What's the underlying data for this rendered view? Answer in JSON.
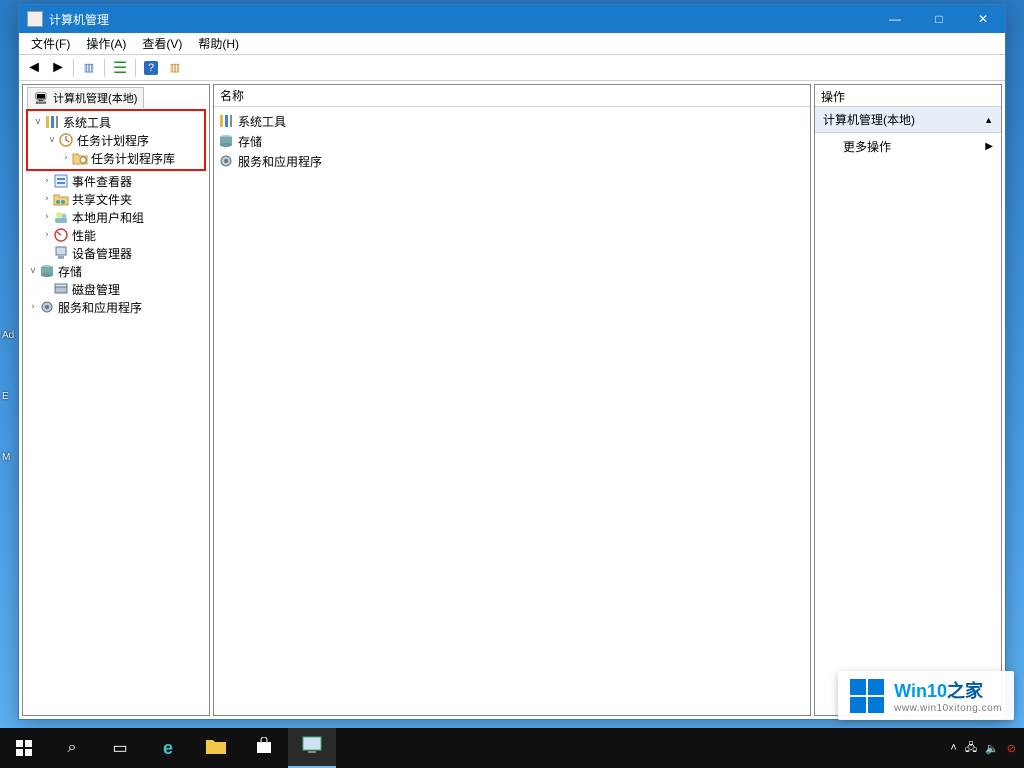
{
  "window": {
    "title": "计算机管理",
    "buttons": {
      "min": "—",
      "max": "□",
      "close": "✕"
    }
  },
  "menu": {
    "file": "文件(F)",
    "action": "操作(A)",
    "view": "查看(V)",
    "help": "帮助(H)"
  },
  "tree": {
    "root_tab": "计算机管理(本地)",
    "system_tools": "系统工具",
    "task_scheduler": "任务计划程序",
    "task_scheduler_lib": "任务计划程序库",
    "event_viewer": "事件查看器",
    "shared_folders": "共享文件夹",
    "local_users_groups": "本地用户和组",
    "performance": "性能",
    "device_manager": "设备管理器",
    "storage": "存储",
    "disk_management": "磁盘管理",
    "services_apps": "服务和应用程序"
  },
  "center": {
    "column_header": "名称",
    "rows": {
      "system_tools": "系统工具",
      "storage": "存储",
      "services_apps": "服务和应用程序"
    }
  },
  "actions": {
    "header": "操作",
    "section": "计算机管理(本地)",
    "more": "更多操作"
  },
  "watermark": {
    "brand_main": "Win10",
    "brand_suffix": "之家",
    "url": "www.win10xitong.com"
  },
  "desktop": {
    "label1": "Ad",
    "label2": "E",
    "label3": "M"
  }
}
